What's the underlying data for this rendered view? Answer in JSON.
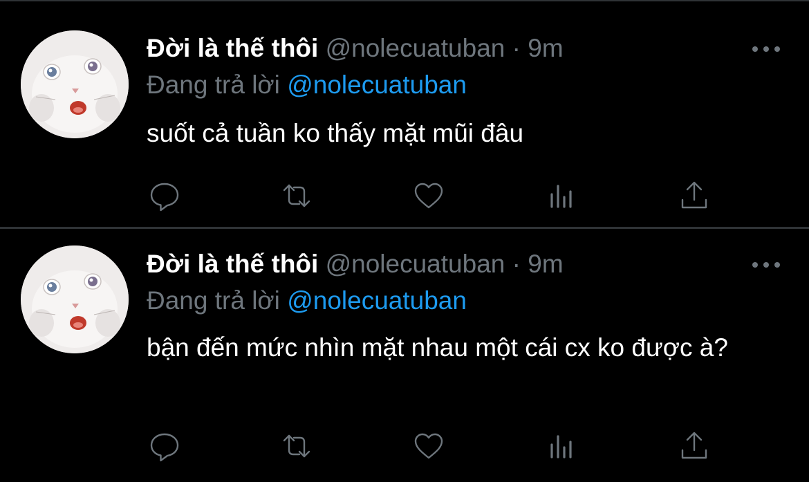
{
  "colors": {
    "background": "#000000",
    "divider": "#2f3336",
    "name": "#ffffff",
    "muted": "#6e767d",
    "mention": "#1d9bf0"
  },
  "tweets": [
    {
      "author_name": "Đời là thế thôi",
      "author_handle": "@nolecuatuban",
      "separator": "·",
      "time": "9m",
      "reply_prefix": "Đang trả lời",
      "reply_to": "@nolecuatuban",
      "text": "suốt cả tuần ko thấy mặt mũi đâu",
      "actions": [
        "reply-icon",
        "retweet-icon",
        "like-icon",
        "analytics-icon",
        "share-icon"
      ]
    },
    {
      "author_name": "Đời là thế thôi",
      "author_handle": "@nolecuatuban",
      "separator": "·",
      "time": "9m",
      "reply_prefix": "Đang trả lời",
      "reply_to": "@nolecuatuban",
      "text": "bận đến mức nhìn mặt nhau một cái cx ko được à?",
      "actions": [
        "reply-icon",
        "retweet-icon",
        "like-icon",
        "analytics-icon",
        "share-icon"
      ]
    }
  ]
}
